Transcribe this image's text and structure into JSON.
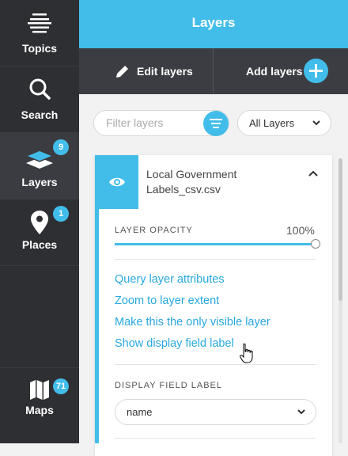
{
  "sidebar": {
    "items": [
      {
        "label": "Topics",
        "icon": "topics-icon"
      },
      {
        "label": "Search",
        "icon": "search-icon"
      },
      {
        "label": "Layers",
        "icon": "layers-icon",
        "badge": "9"
      },
      {
        "label": "Places",
        "icon": "pin-icon",
        "badge": "1"
      },
      {
        "label": "Maps",
        "icon": "map-icon",
        "badge": "71"
      }
    ]
  },
  "header": {
    "title": "Layers"
  },
  "actions": {
    "edit_label": "Edit layers",
    "add_label": "Add layers"
  },
  "filter": {
    "placeholder": "Filter layers",
    "select_value": "All Layers"
  },
  "layer": {
    "title_line1": "Local Government",
    "title_line2": "Labels_csv.csv",
    "opacity_label": "LAYER OPACITY",
    "opacity_value": "100%",
    "opacity": 1.0,
    "links": [
      "Query layer attributes",
      "Zoom to layer extent",
      "Make this the only visible layer",
      "Show display field label"
    ],
    "display_field_label": "DISPLAY FIELD LABEL",
    "display_field_value": "name"
  },
  "colors": {
    "accent": "#42bdea",
    "sidebar": "#2e2f33",
    "link": "#29a8e0"
  }
}
